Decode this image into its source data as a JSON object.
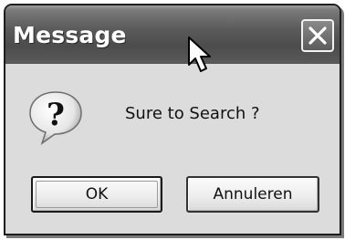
{
  "dialog": {
    "title": "Message",
    "close_icon": "close-icon",
    "icon": "question-icon",
    "message": "Sure to Search ?",
    "buttons": {
      "ok_label": "OK",
      "cancel_label": "Annuleren"
    }
  }
}
